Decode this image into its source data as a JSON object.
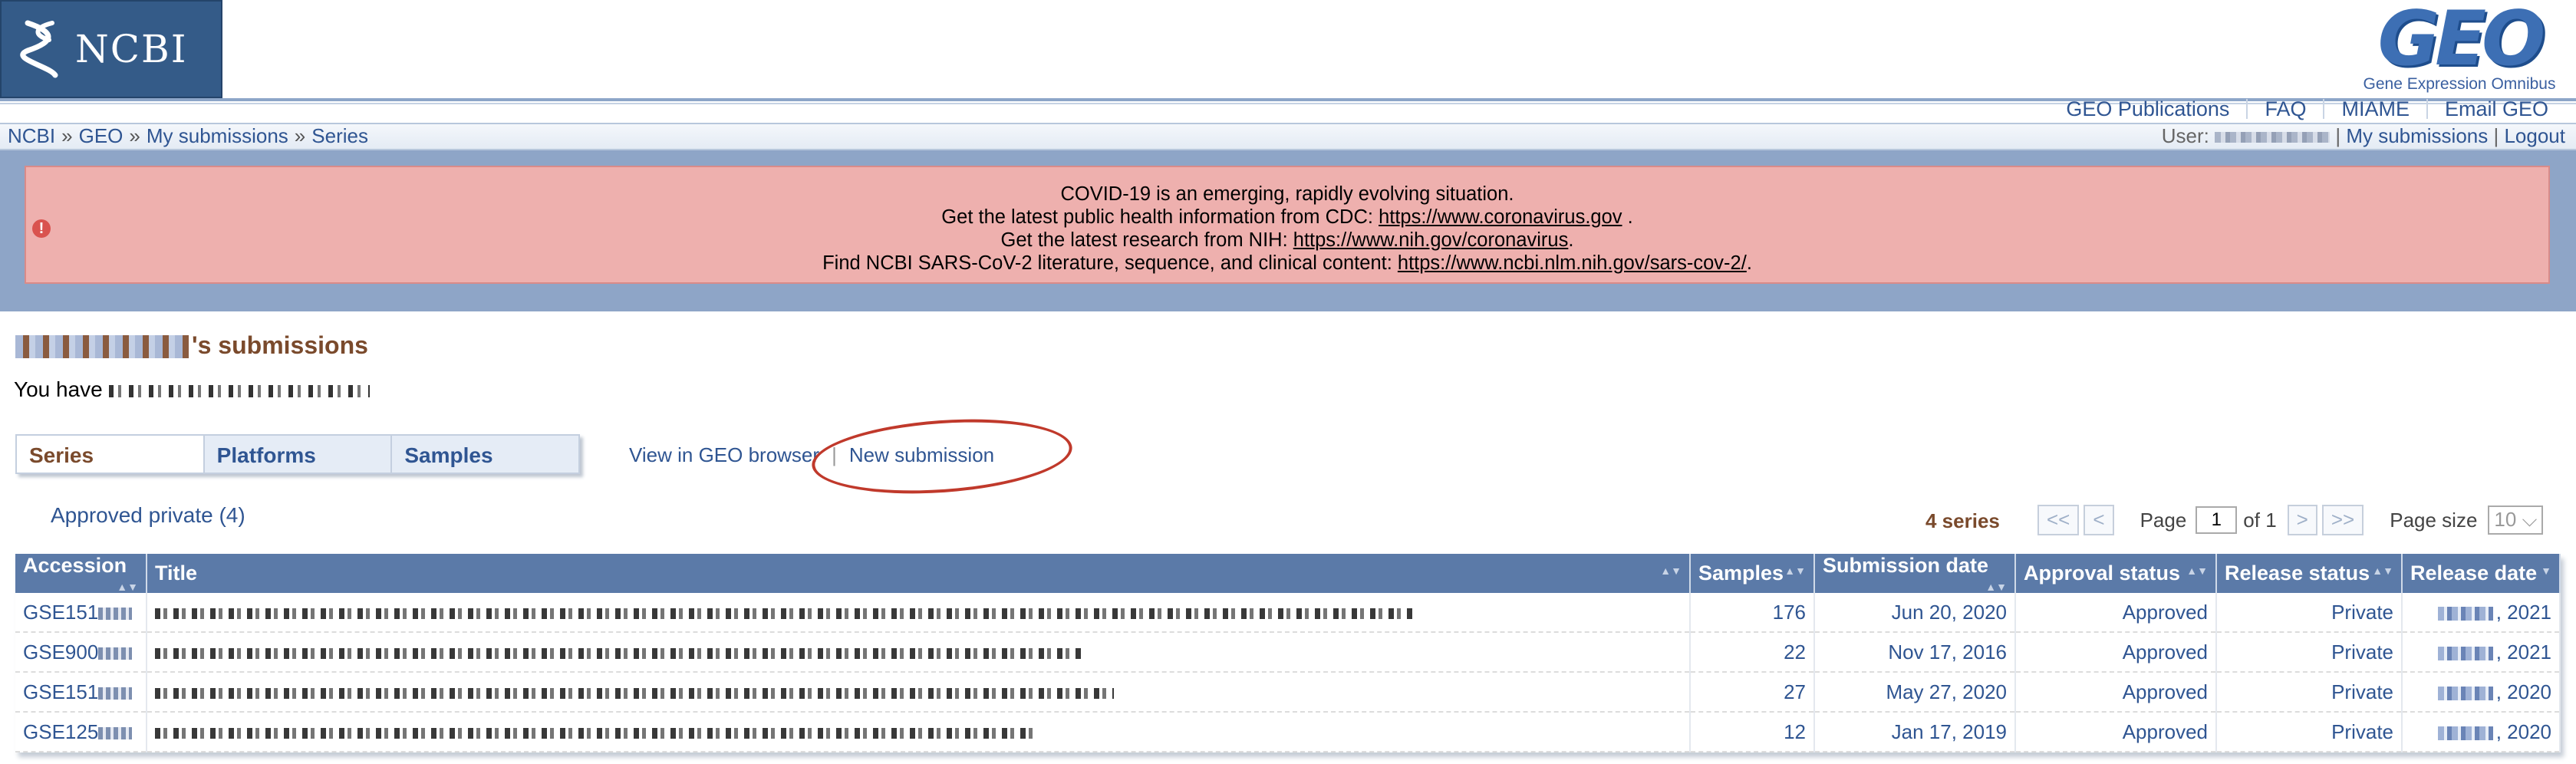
{
  "header": {
    "ncbi_logo_text": "NCBI",
    "geo_logo_text": "GEO",
    "geo_logo_subtitle": "Gene Expression Omnibus",
    "top_links": [
      "GEO Publications",
      "FAQ",
      "MIAME",
      "Email GEO"
    ]
  },
  "breadcrumb": [
    "NCBI",
    "GEO",
    "My submissions",
    "Series"
  ],
  "userbar": {
    "user_label": "User:",
    "my_submissions": "My submissions",
    "logout": "Logout"
  },
  "alert": {
    "line1": "COVID-19 is an emerging, rapidly evolving situation.",
    "line2_text": "Get the latest public health information from CDC:",
    "line2_link": "https://www.coronavirus.gov",
    "line3_text": "Get the latest research from NIH:",
    "line3_link": "https://www.nih.gov/coronavirus",
    "line4_text": "Find NCBI SARS-CoV-2 literature, sequence, and clinical content:",
    "line4_link": "https://www.ncbi.nlm.nih.gov/sars-cov-2/"
  },
  "page": {
    "title_suffix": "'s submissions",
    "count_prefix": "You have"
  },
  "tabs": [
    "Series",
    "Platforms",
    "Samples"
  ],
  "actions": {
    "view_geo": "View in GEO browser",
    "new_submission": "New submission"
  },
  "filter": {
    "approved_private": "Approved private (4)"
  },
  "pager": {
    "series_count": "4 series",
    "first": "<<",
    "prev": "<",
    "page_label": "Page",
    "page_value": "1",
    "of_label": "of 1",
    "next": ">",
    "last": ">>",
    "page_size_label": "Page size",
    "page_size_value": "10"
  },
  "table": {
    "columns": [
      "Accession",
      "Title",
      "Samples",
      "Submission date",
      "Approval status",
      "Release status",
      "Release date"
    ],
    "rows": [
      {
        "accession": "GSE151",
        "samples": "176",
        "submission_date": "Jun 20, 2020",
        "approval": "Approved",
        "release_status": "Private",
        "release_year": ", 2021"
      },
      {
        "accession": "GSE900",
        "samples": "22",
        "submission_date": "Nov 17, 2016",
        "approval": "Approved",
        "release_status": "Private",
        "release_year": ", 2021"
      },
      {
        "accession": "GSE151",
        "samples": "27",
        "submission_date": "May 27, 2020",
        "approval": "Approved",
        "release_status": "Private",
        "release_year": ", 2020"
      },
      {
        "accession": "GSE125",
        "samples": "12",
        "submission_date": "Jan 17, 2019",
        "approval": "Approved",
        "release_status": "Private",
        "release_year": ", 2020"
      }
    ]
  },
  "colors": {
    "ncbi_blue": "#345b88",
    "link_blue": "#2f5592",
    "table_header": "#5b7aa8",
    "alert_bg": "#eeb0ae",
    "title_brown": "#7a4a2c",
    "annotation_red": "#c0392b"
  },
  "icons": {
    "ncbi_logo": "dna-helix-icon",
    "alert": "alert-circle-icon",
    "sort": "sort-arrows-icon"
  }
}
